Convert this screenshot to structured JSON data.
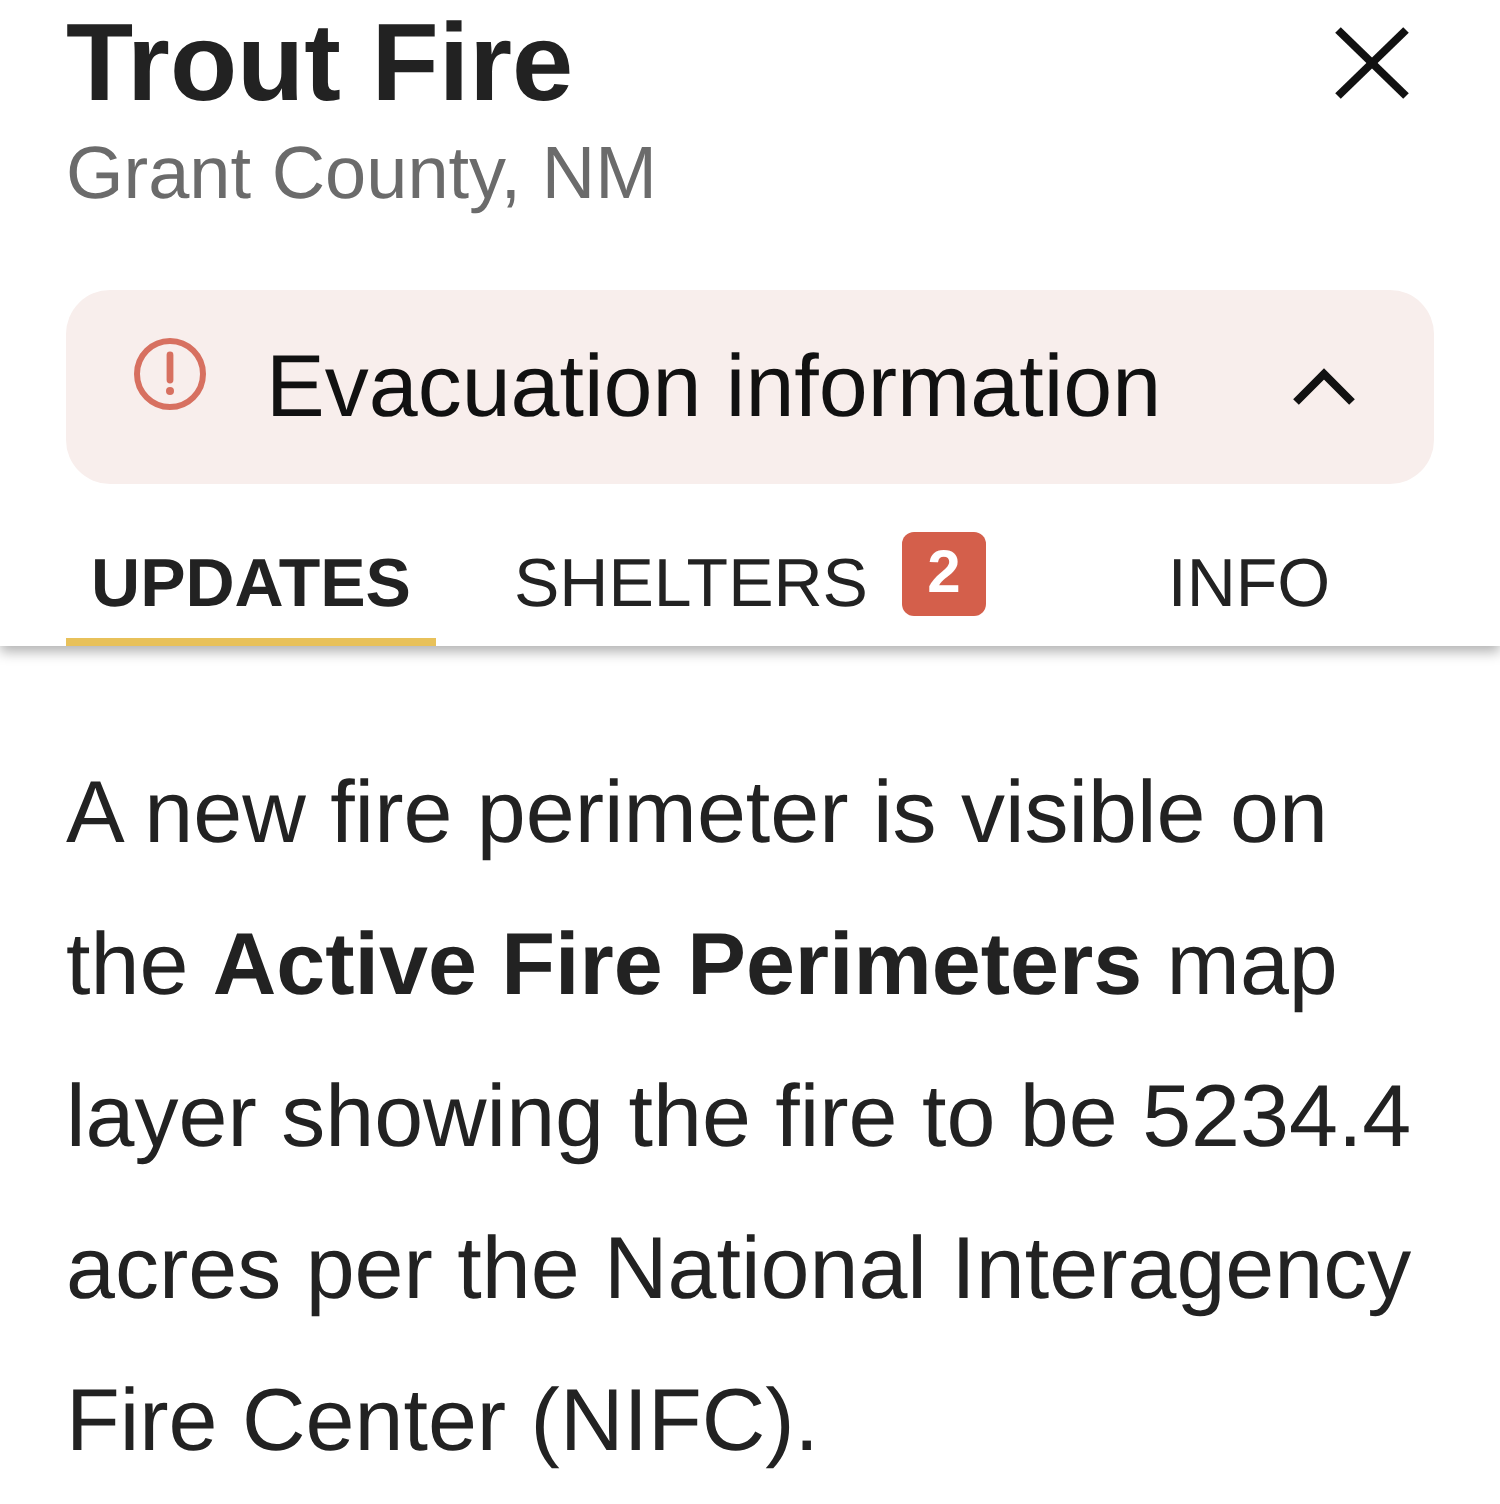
{
  "header": {
    "title": "Trout Fire",
    "subtitle": "Grant County, NM"
  },
  "evacuation": {
    "label": "Evacuation information",
    "expanded": true
  },
  "tabs": [
    {
      "label": "UPDATES",
      "selected": true
    },
    {
      "label": "SHELTERS",
      "selected": false,
      "badge": "2"
    },
    {
      "label": "INFO",
      "selected": false
    }
  ],
  "update": {
    "text": "A new fire perimeter is visible on the **Active Fire Perimeters** map layer showing the fire to be 5234.4 acres per the National Interagency Fire Center (NIFC)."
  }
}
